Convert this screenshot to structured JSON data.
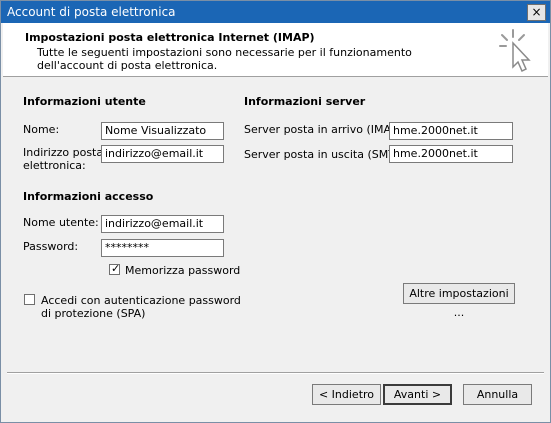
{
  "window": {
    "title": "Account di posta elettronica",
    "close_glyph": "×"
  },
  "header": {
    "title": "Impostazioni posta elettronica Internet (IMAP)",
    "description": "Tutte le seguenti impostazioni sono necessarie per il funzionamento dell'account di posta elettronica."
  },
  "user_info": {
    "title": "Informazioni utente",
    "name_label": "Nome:",
    "name_value": "Nome Visualizzato",
    "email_label_line1": "Indirizzo posta",
    "email_label_line2": "elettronica:",
    "email_value": "indirizzo@email.it"
  },
  "server_info": {
    "title": "Informazioni server",
    "incoming_label": "Server posta in arrivo (IMAP):",
    "incoming_value": "hme.2000net.it",
    "outgoing_label": "Server posta in uscita (SMTP):",
    "outgoing_value": "hme.2000net.it"
  },
  "access_info": {
    "title": "Informazioni accesso",
    "username_label": "Nome utente:",
    "username_value": "indirizzo@email.it",
    "password_label": "Password:",
    "password_value": "********",
    "remember_label": "Memorizza password",
    "remember_checked": true,
    "spa_label_line1": "Accedi con autenticazione password",
    "spa_label_line2": "di protezione (SPA)",
    "spa_checked": false
  },
  "buttons": {
    "more_settings": "Altre impostazioni ...",
    "back": "< Indietro",
    "next": "Avanti >",
    "cancel": "Annulla"
  }
}
